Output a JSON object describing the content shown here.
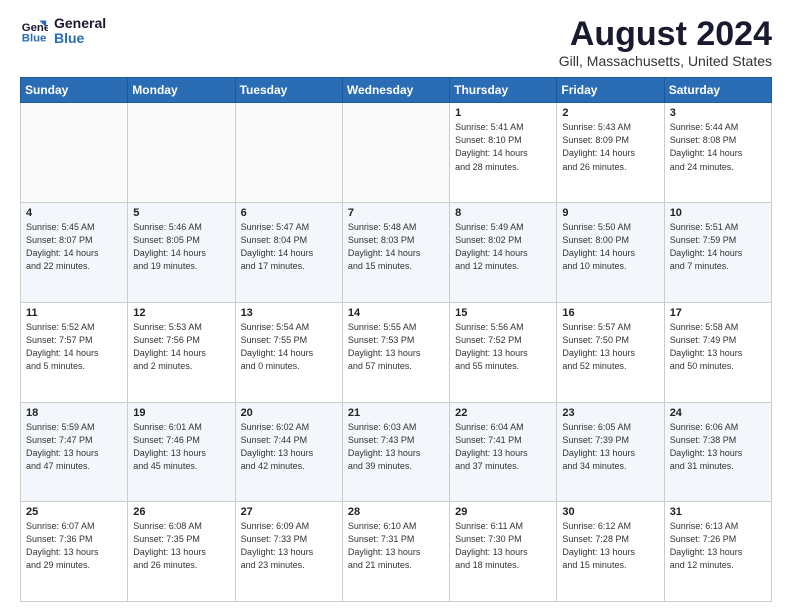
{
  "header": {
    "logo_general": "General",
    "logo_blue": "Blue",
    "month_year": "August 2024",
    "location": "Gill, Massachusetts, United States"
  },
  "weekdays": [
    "Sunday",
    "Monday",
    "Tuesday",
    "Wednesday",
    "Thursday",
    "Friday",
    "Saturday"
  ],
  "weeks": [
    [
      {
        "day": "",
        "info": ""
      },
      {
        "day": "",
        "info": ""
      },
      {
        "day": "",
        "info": ""
      },
      {
        "day": "",
        "info": ""
      },
      {
        "day": "1",
        "info": "Sunrise: 5:41 AM\nSunset: 8:10 PM\nDaylight: 14 hours\nand 28 minutes."
      },
      {
        "day": "2",
        "info": "Sunrise: 5:43 AM\nSunset: 8:09 PM\nDaylight: 14 hours\nand 26 minutes."
      },
      {
        "day": "3",
        "info": "Sunrise: 5:44 AM\nSunset: 8:08 PM\nDaylight: 14 hours\nand 24 minutes."
      }
    ],
    [
      {
        "day": "4",
        "info": "Sunrise: 5:45 AM\nSunset: 8:07 PM\nDaylight: 14 hours\nand 22 minutes."
      },
      {
        "day": "5",
        "info": "Sunrise: 5:46 AM\nSunset: 8:05 PM\nDaylight: 14 hours\nand 19 minutes."
      },
      {
        "day": "6",
        "info": "Sunrise: 5:47 AM\nSunset: 8:04 PM\nDaylight: 14 hours\nand 17 minutes."
      },
      {
        "day": "7",
        "info": "Sunrise: 5:48 AM\nSunset: 8:03 PM\nDaylight: 14 hours\nand 15 minutes."
      },
      {
        "day": "8",
        "info": "Sunrise: 5:49 AM\nSunset: 8:02 PM\nDaylight: 14 hours\nand 12 minutes."
      },
      {
        "day": "9",
        "info": "Sunrise: 5:50 AM\nSunset: 8:00 PM\nDaylight: 14 hours\nand 10 minutes."
      },
      {
        "day": "10",
        "info": "Sunrise: 5:51 AM\nSunset: 7:59 PM\nDaylight: 14 hours\nand 7 minutes."
      }
    ],
    [
      {
        "day": "11",
        "info": "Sunrise: 5:52 AM\nSunset: 7:57 PM\nDaylight: 14 hours\nand 5 minutes."
      },
      {
        "day": "12",
        "info": "Sunrise: 5:53 AM\nSunset: 7:56 PM\nDaylight: 14 hours\nand 2 minutes."
      },
      {
        "day": "13",
        "info": "Sunrise: 5:54 AM\nSunset: 7:55 PM\nDaylight: 14 hours\nand 0 minutes."
      },
      {
        "day": "14",
        "info": "Sunrise: 5:55 AM\nSunset: 7:53 PM\nDaylight: 13 hours\nand 57 minutes."
      },
      {
        "day": "15",
        "info": "Sunrise: 5:56 AM\nSunset: 7:52 PM\nDaylight: 13 hours\nand 55 minutes."
      },
      {
        "day": "16",
        "info": "Sunrise: 5:57 AM\nSunset: 7:50 PM\nDaylight: 13 hours\nand 52 minutes."
      },
      {
        "day": "17",
        "info": "Sunrise: 5:58 AM\nSunset: 7:49 PM\nDaylight: 13 hours\nand 50 minutes."
      }
    ],
    [
      {
        "day": "18",
        "info": "Sunrise: 5:59 AM\nSunset: 7:47 PM\nDaylight: 13 hours\nand 47 minutes."
      },
      {
        "day": "19",
        "info": "Sunrise: 6:01 AM\nSunset: 7:46 PM\nDaylight: 13 hours\nand 45 minutes."
      },
      {
        "day": "20",
        "info": "Sunrise: 6:02 AM\nSunset: 7:44 PM\nDaylight: 13 hours\nand 42 minutes."
      },
      {
        "day": "21",
        "info": "Sunrise: 6:03 AM\nSunset: 7:43 PM\nDaylight: 13 hours\nand 39 minutes."
      },
      {
        "day": "22",
        "info": "Sunrise: 6:04 AM\nSunset: 7:41 PM\nDaylight: 13 hours\nand 37 minutes."
      },
      {
        "day": "23",
        "info": "Sunrise: 6:05 AM\nSunset: 7:39 PM\nDaylight: 13 hours\nand 34 minutes."
      },
      {
        "day": "24",
        "info": "Sunrise: 6:06 AM\nSunset: 7:38 PM\nDaylight: 13 hours\nand 31 minutes."
      }
    ],
    [
      {
        "day": "25",
        "info": "Sunrise: 6:07 AM\nSunset: 7:36 PM\nDaylight: 13 hours\nand 29 minutes."
      },
      {
        "day": "26",
        "info": "Sunrise: 6:08 AM\nSunset: 7:35 PM\nDaylight: 13 hours\nand 26 minutes."
      },
      {
        "day": "27",
        "info": "Sunrise: 6:09 AM\nSunset: 7:33 PM\nDaylight: 13 hours\nand 23 minutes."
      },
      {
        "day": "28",
        "info": "Sunrise: 6:10 AM\nSunset: 7:31 PM\nDaylight: 13 hours\nand 21 minutes."
      },
      {
        "day": "29",
        "info": "Sunrise: 6:11 AM\nSunset: 7:30 PM\nDaylight: 13 hours\nand 18 minutes."
      },
      {
        "day": "30",
        "info": "Sunrise: 6:12 AM\nSunset: 7:28 PM\nDaylight: 13 hours\nand 15 minutes."
      },
      {
        "day": "31",
        "info": "Sunrise: 6:13 AM\nSunset: 7:26 PM\nDaylight: 13 hours\nand 12 minutes."
      }
    ]
  ]
}
